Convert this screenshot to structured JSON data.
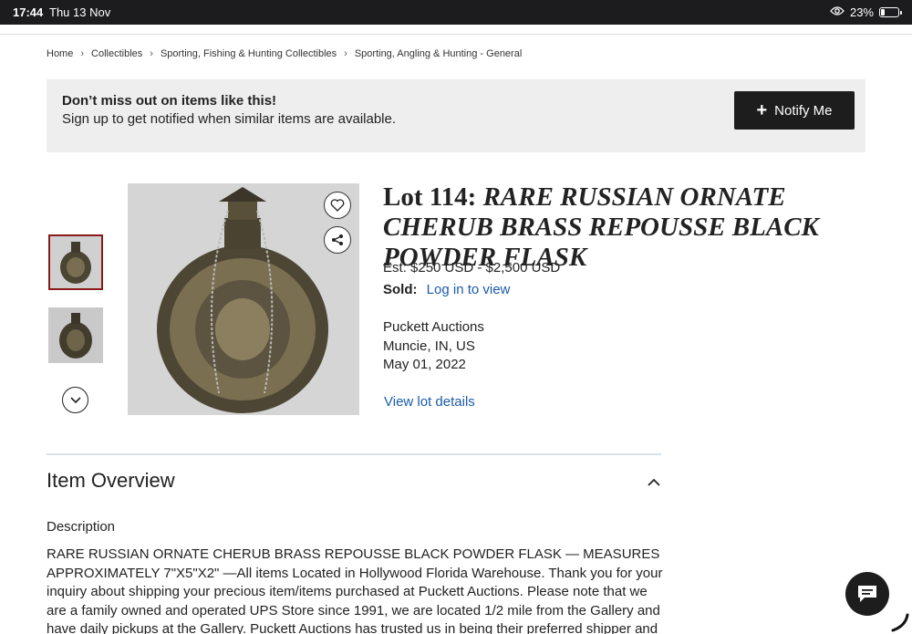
{
  "status_bar": {
    "time": "17:44",
    "date": "Thu 13 Nov",
    "battery": "23%",
    "battery_level": 0.23
  },
  "breadcrumb": [
    "Home",
    "Collectibles",
    "Sporting, Fishing & Hunting Collectibles",
    "Sporting, Angling & Hunting - General"
  ],
  "notify_banner": {
    "title": "Don’t miss out on items like this!",
    "subtitle": "Sign up to get notified when similar items are available.",
    "button_label": "Notify Me"
  },
  "lot": {
    "lot_prefix": "Lot 114:",
    "name": "RARE RUSSIAN ORNATE CHERUB BRASS REPOUSSE BLACK POWDER FLASK",
    "estimate": "Est: $250 USD - $2,500 USD",
    "sold_label": "Sold:",
    "sold_link": "Log in to view",
    "auction_house": "Puckett Auctions",
    "location": "Muncie, IN, US",
    "date": "May 01, 2022",
    "view_details": "View lot details"
  },
  "overview": {
    "title": "Item Overview",
    "description_label": "Description",
    "description": "RARE RUSSIAN ORNATE CHERUB BRASS REPOUSSE BLACK POWDER FLASK — MEASURES APPROXIMATELY 7\"X5\"X2\" —All items Located in Hollywood Florida Warehouse. Thank you for your inquiry about shipping your precious item/items purchased at Puckett Auctions. Please note that we are a family owned and operated UPS Store since 1991, we are located 1/2 mile from the Gallery and have daily pickups at the Gallery. Puckett Auctions has trusted us in being their preferred shipper and we ask that you do the same. Being"
  },
  "colors": {
    "accent_link": "#1a5bab",
    "thumb_active_border": "#8b1a1a",
    "button_dark": "#1d1d1d"
  }
}
